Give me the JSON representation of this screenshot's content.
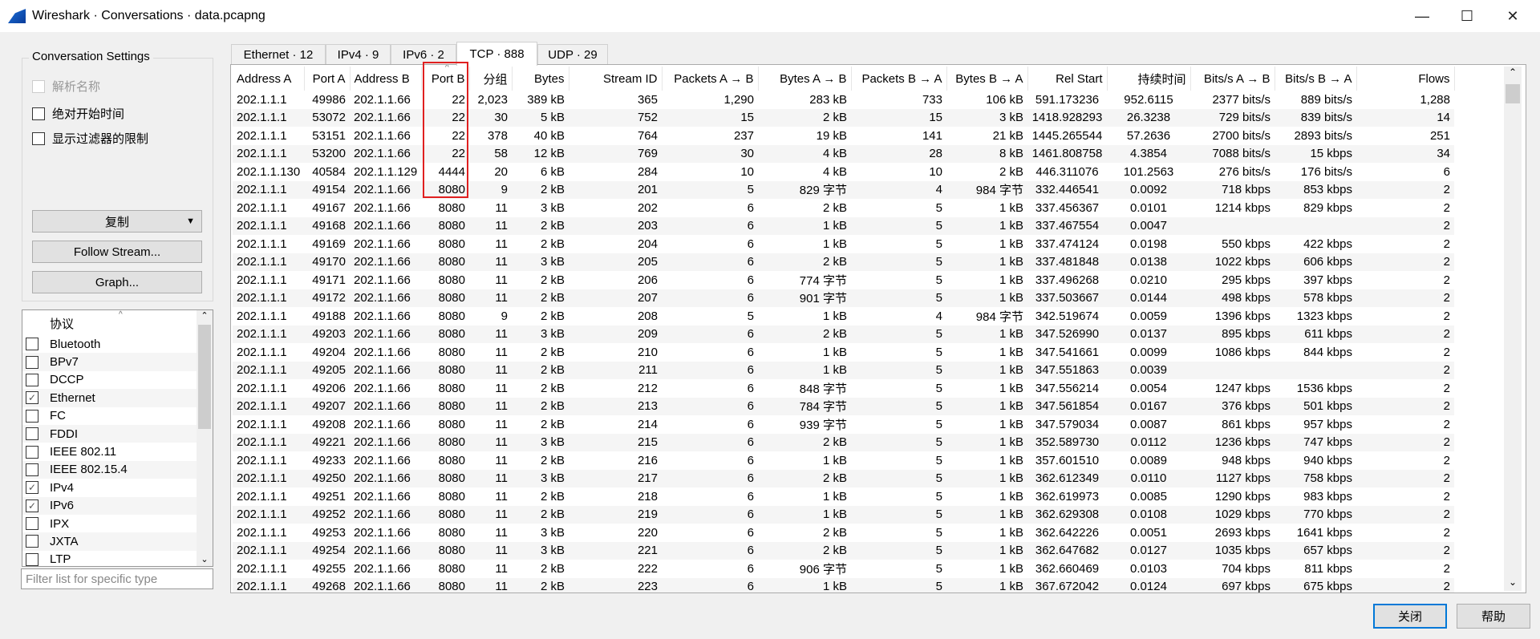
{
  "window": {
    "title": "Wireshark · Conversations · data.pcapng",
    "controls": [
      "minimize-icon",
      "maximize-icon",
      "close-icon"
    ]
  },
  "settings": {
    "title": "Conversation Settings",
    "options": [
      {
        "label": "解析名称",
        "checked": false,
        "disabled": true
      },
      {
        "label": "绝对开始时间",
        "checked": false,
        "disabled": false
      },
      {
        "label": "显示过滤器的限制",
        "checked": false,
        "disabled": false
      }
    ],
    "copy_label": "复制",
    "follow_label": "Follow Stream...",
    "graph_label": "Graph..."
  },
  "protocols": {
    "header": "协议",
    "items": [
      {
        "label": "Bluetooth",
        "checked": false
      },
      {
        "label": "BPv7",
        "checked": false
      },
      {
        "label": "DCCP",
        "checked": false
      },
      {
        "label": "Ethernet",
        "checked": true
      },
      {
        "label": "FC",
        "checked": false
      },
      {
        "label": "FDDI",
        "checked": false
      },
      {
        "label": "IEEE 802.11",
        "checked": false
      },
      {
        "label": "IEEE 802.15.4",
        "checked": false
      },
      {
        "label": "IPv4",
        "checked": true
      },
      {
        "label": "IPv6",
        "checked": true
      },
      {
        "label": "IPX",
        "checked": false
      },
      {
        "label": "JXTA",
        "checked": false
      },
      {
        "label": "LTP",
        "checked": false
      }
    ],
    "filter_placeholder": "Filter list for specific type"
  },
  "tabs": [
    {
      "label": "Ethernet · 12"
    },
    {
      "label": "IPv4 · 9"
    },
    {
      "label": "IPv6 · 2"
    },
    {
      "label": "TCP · 888",
      "selected": true
    },
    {
      "label": "UDP · 29"
    }
  ],
  "table": {
    "sorted_column": "Port B",
    "highlight_color": "#e02020",
    "columns": [
      "Address A",
      "Port A",
      "Address B",
      "Port B",
      "分组",
      "Bytes",
      "Stream ID",
      "Packets A → B",
      "Bytes A → B",
      "Packets B → A",
      "Bytes B → A",
      "Rel Start",
      "持续时间",
      "Bits/s A → B",
      "Bits/s B → A",
      "Flows"
    ],
    "rows": [
      [
        "202.1.1.1",
        "49986",
        "202.1.1.66",
        "22",
        "2,023",
        "389 kB",
        "365",
        "1,290",
        "283 kB",
        "733",
        "106 kB",
        "591.173236",
        "952.6115",
        "2377 bits/s",
        "889 bits/s",
        "1,288"
      ],
      [
        "202.1.1.1",
        "53072",
        "202.1.1.66",
        "22",
        "30",
        "5 kB",
        "752",
        "15",
        "2 kB",
        "15",
        "3 kB",
        "1418.928293",
        "26.3238",
        "729 bits/s",
        "839 bits/s",
        "14"
      ],
      [
        "202.1.1.1",
        "53151",
        "202.1.1.66",
        "22",
        "378",
        "40 kB",
        "764",
        "237",
        "19 kB",
        "141",
        "21 kB",
        "1445.265544",
        "57.2636",
        "2700 bits/s",
        "2893 bits/s",
        "251"
      ],
      [
        "202.1.1.1",
        "53200",
        "202.1.1.66",
        "22",
        "58",
        "12 kB",
        "769",
        "30",
        "4 kB",
        "28",
        "8 kB",
        "1461.808758",
        "4.3854",
        "7088 bits/s",
        "15 kbps",
        "34"
      ],
      [
        "202.1.1.130",
        "40584",
        "202.1.1.129",
        "4444",
        "20",
        "6 kB",
        "284",
        "10",
        "4 kB",
        "10",
        "2 kB",
        "446.311076",
        "101.2563",
        "276 bits/s",
        "176 bits/s",
        "6"
      ],
      [
        "202.1.1.1",
        "49154",
        "202.1.1.66",
        "8080",
        "9",
        "2 kB",
        "201",
        "5",
        "829 字节",
        "4",
        "984 字节",
        "332.446541",
        "0.0092",
        "718 kbps",
        "853 kbps",
        "2"
      ],
      [
        "202.1.1.1",
        "49167",
        "202.1.1.66",
        "8080",
        "11",
        "3 kB",
        "202",
        "6",
        "2 kB",
        "5",
        "1 kB",
        "337.456367",
        "0.0101",
        "1214 kbps",
        "829 kbps",
        "2"
      ],
      [
        "202.1.1.1",
        "49168",
        "202.1.1.66",
        "8080",
        "11",
        "2 kB",
        "203",
        "6",
        "1 kB",
        "5",
        "1 kB",
        "337.467554",
        "0.0047",
        "",
        "",
        "2"
      ],
      [
        "202.1.1.1",
        "49169",
        "202.1.1.66",
        "8080",
        "11",
        "2 kB",
        "204",
        "6",
        "1 kB",
        "5",
        "1 kB",
        "337.474124",
        "0.0198",
        "550 kbps",
        "422 kbps",
        "2"
      ],
      [
        "202.1.1.1",
        "49170",
        "202.1.1.66",
        "8080",
        "11",
        "3 kB",
        "205",
        "6",
        "2 kB",
        "5",
        "1 kB",
        "337.481848",
        "0.0138",
        "1022 kbps",
        "606 kbps",
        "2"
      ],
      [
        "202.1.1.1",
        "49171",
        "202.1.1.66",
        "8080",
        "11",
        "2 kB",
        "206",
        "6",
        "774 字节",
        "5",
        "1 kB",
        "337.496268",
        "0.0210",
        "295 kbps",
        "397 kbps",
        "2"
      ],
      [
        "202.1.1.1",
        "49172",
        "202.1.1.66",
        "8080",
        "11",
        "2 kB",
        "207",
        "6",
        "901 字节",
        "5",
        "1 kB",
        "337.503667",
        "0.0144",
        "498 kbps",
        "578 kbps",
        "2"
      ],
      [
        "202.1.1.1",
        "49188",
        "202.1.1.66",
        "8080",
        "9",
        "2 kB",
        "208",
        "5",
        "1 kB",
        "4",
        "984 字节",
        "342.519674",
        "0.0059",
        "1396 kbps",
        "1323 kbps",
        "2"
      ],
      [
        "202.1.1.1",
        "49203",
        "202.1.1.66",
        "8080",
        "11",
        "3 kB",
        "209",
        "6",
        "2 kB",
        "5",
        "1 kB",
        "347.526990",
        "0.0137",
        "895 kbps",
        "611 kbps",
        "2"
      ],
      [
        "202.1.1.1",
        "49204",
        "202.1.1.66",
        "8080",
        "11",
        "2 kB",
        "210",
        "6",
        "1 kB",
        "5",
        "1 kB",
        "347.541661",
        "0.0099",
        "1086 kbps",
        "844 kbps",
        "2"
      ],
      [
        "202.1.1.1",
        "49205",
        "202.1.1.66",
        "8080",
        "11",
        "2 kB",
        "211",
        "6",
        "1 kB",
        "5",
        "1 kB",
        "347.551863",
        "0.0039",
        "",
        "",
        "2"
      ],
      [
        "202.1.1.1",
        "49206",
        "202.1.1.66",
        "8080",
        "11",
        "2 kB",
        "212",
        "6",
        "848 字节",
        "5",
        "1 kB",
        "347.556214",
        "0.0054",
        "1247 kbps",
        "1536 kbps",
        "2"
      ],
      [
        "202.1.1.1",
        "49207",
        "202.1.1.66",
        "8080",
        "11",
        "2 kB",
        "213",
        "6",
        "784 字节",
        "5",
        "1 kB",
        "347.561854",
        "0.0167",
        "376 kbps",
        "501 kbps",
        "2"
      ],
      [
        "202.1.1.1",
        "49208",
        "202.1.1.66",
        "8080",
        "11",
        "2 kB",
        "214",
        "6",
        "939 字节",
        "5",
        "1 kB",
        "347.579034",
        "0.0087",
        "861 kbps",
        "957 kbps",
        "2"
      ],
      [
        "202.1.1.1",
        "49221",
        "202.1.1.66",
        "8080",
        "11",
        "3 kB",
        "215",
        "6",
        "2 kB",
        "5",
        "1 kB",
        "352.589730",
        "0.0112",
        "1236 kbps",
        "747 kbps",
        "2"
      ],
      [
        "202.1.1.1",
        "49233",
        "202.1.1.66",
        "8080",
        "11",
        "2 kB",
        "216",
        "6",
        "1 kB",
        "5",
        "1 kB",
        "357.601510",
        "0.0089",
        "948 kbps",
        "940 kbps",
        "2"
      ],
      [
        "202.1.1.1",
        "49250",
        "202.1.1.66",
        "8080",
        "11",
        "3 kB",
        "217",
        "6",
        "2 kB",
        "5",
        "1 kB",
        "362.612349",
        "0.0110",
        "1127 kbps",
        "758 kbps",
        "2"
      ],
      [
        "202.1.1.1",
        "49251",
        "202.1.1.66",
        "8080",
        "11",
        "2 kB",
        "218",
        "6",
        "1 kB",
        "5",
        "1 kB",
        "362.619973",
        "0.0085",
        "1290 kbps",
        "983 kbps",
        "2"
      ],
      [
        "202.1.1.1",
        "49252",
        "202.1.1.66",
        "8080",
        "11",
        "2 kB",
        "219",
        "6",
        "1 kB",
        "5",
        "1 kB",
        "362.629308",
        "0.0108",
        "1029 kbps",
        "770 kbps",
        "2"
      ],
      [
        "202.1.1.1",
        "49253",
        "202.1.1.66",
        "8080",
        "11",
        "3 kB",
        "220",
        "6",
        "2 kB",
        "5",
        "1 kB",
        "362.642226",
        "0.0051",
        "2693 kbps",
        "1641 kbps",
        "2"
      ],
      [
        "202.1.1.1",
        "49254",
        "202.1.1.66",
        "8080",
        "11",
        "3 kB",
        "221",
        "6",
        "2 kB",
        "5",
        "1 kB",
        "362.647682",
        "0.0127",
        "1035 kbps",
        "657 kbps",
        "2"
      ],
      [
        "202.1.1.1",
        "49255",
        "202.1.1.66",
        "8080",
        "11",
        "2 kB",
        "222",
        "6",
        "906 字节",
        "5",
        "1 kB",
        "362.660469",
        "0.0103",
        "704 kbps",
        "811 kbps",
        "2"
      ],
      [
        "202.1.1.1",
        "49268",
        "202.1.1.66",
        "8080",
        "11",
        "2 kB",
        "223",
        "6",
        "1 kB",
        "5",
        "1 kB",
        "367.672042",
        "0.0124",
        "697 kbps",
        "675 kbps",
        "2"
      ]
    ]
  },
  "footer": {
    "close_label": "关闭",
    "help_label": "帮助"
  }
}
